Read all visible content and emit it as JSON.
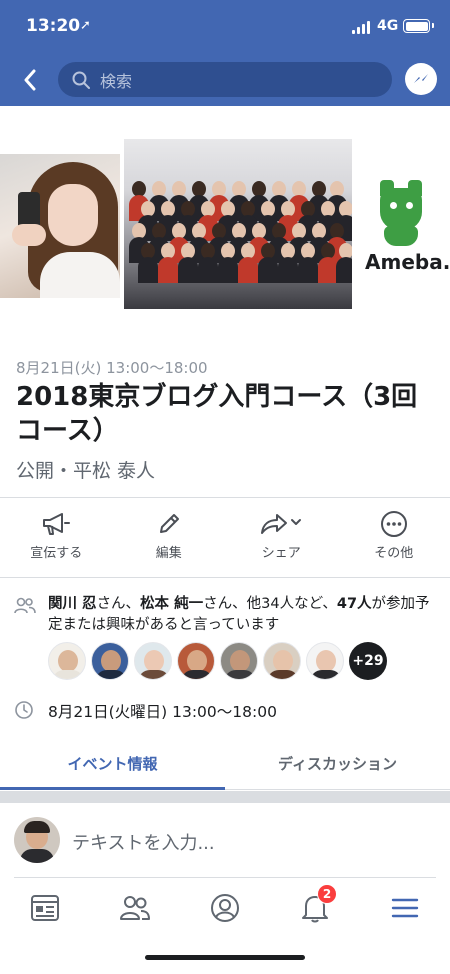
{
  "status_bar": {
    "time": "13:20",
    "location_glyph": "➚",
    "network": "4G"
  },
  "header": {
    "search_placeholder": "検索",
    "accent_color": "#4267b2"
  },
  "cover": {
    "brand_text": "Ameba."
  },
  "event": {
    "date": "8月21日(火) 13:00〜18:00",
    "title": "2018東京ブログ入門コース（3回コース）",
    "meta": "公開・平松 泰人"
  },
  "actions": [
    {
      "label": "宣伝する",
      "icon": "megaphone-icon"
    },
    {
      "label": "編集",
      "icon": "pencil-icon"
    },
    {
      "label": "シェア",
      "icon": "share-icon"
    },
    {
      "label": "その他",
      "icon": "more-icon"
    }
  ],
  "attendance": {
    "name1": "関川 忍",
    "suffix1": "さん、",
    "name2": "松本 純一",
    "suffix2": "さん、他34人など、",
    "count": "47人",
    "tail": "が参加予定または興味があると言っています",
    "more_count": "+29"
  },
  "schedule": {
    "datetime": "8月21日(火曜日) 13:00〜18:00"
  },
  "tabs": [
    {
      "label": "イベント情報",
      "active": true
    },
    {
      "label": "ディスカッション",
      "active": false
    }
  ],
  "composer": {
    "placeholder": "テキストを入力..."
  },
  "tabbar": {
    "notification_badge": "2",
    "active_color": "#4267b2"
  }
}
